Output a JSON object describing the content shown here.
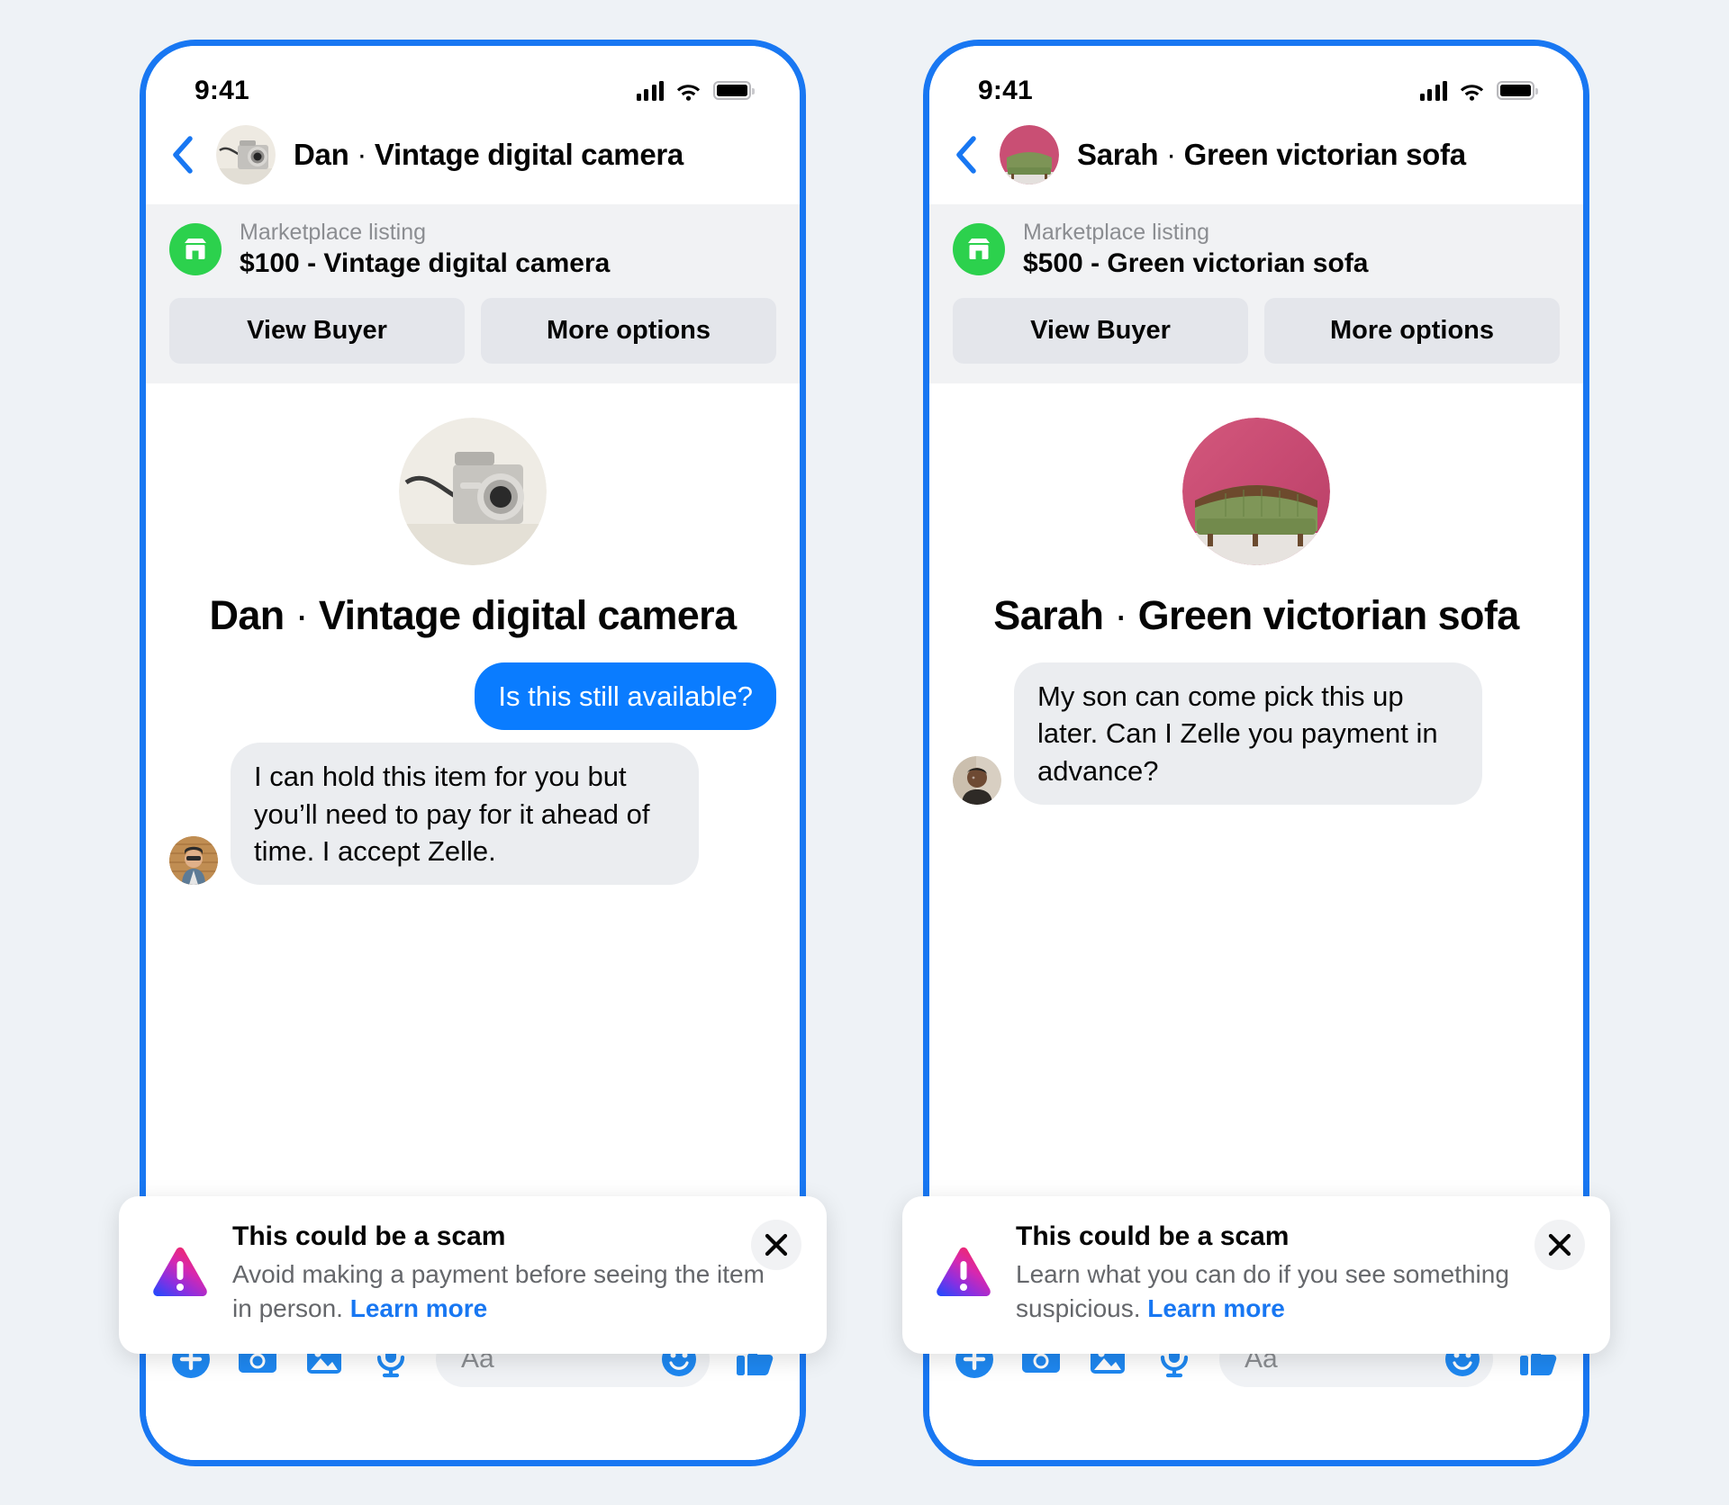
{
  "theme": {
    "page_background": "#eef2f6",
    "phone_frame": "#1877f2",
    "accent_blue": "#1877f2",
    "bubble_out": "#0a7cff",
    "bubble_in": "#ebedf0",
    "marketplace_green": "#2cd14d",
    "muted_text": "#65676b"
  },
  "phones": [
    {
      "status": {
        "time": "9:41",
        "signal_icon": "cellular-signal-icon",
        "wifi_icon": "wifi-icon",
        "battery_icon": "battery-full-icon"
      },
      "header": {
        "back_icon": "back-chevron-icon",
        "avatar_name": "vintage-digital-camera-avatar",
        "title_name": "Dan",
        "title_separator": " · ",
        "title_item": "Vintage digital camera"
      },
      "listing": {
        "store_icon": "marketplace-storefront-icon",
        "label": "Marketplace listing",
        "title": "$100 - Vintage digital camera",
        "price": "$100",
        "item": "Vintage digital camera",
        "buttons": [
          {
            "label": "View Buyer",
            "name": "view-buyer-button"
          },
          {
            "label": "More options",
            "name": "more-options-button"
          }
        ]
      },
      "intro": {
        "avatar_name": "vintage-digital-camera-photo",
        "name": "Dan",
        "separator": " · ",
        "item": "Vintage digital camera"
      },
      "messages": [
        {
          "direction": "out",
          "text": "Is this still available?",
          "avatar": null
        },
        {
          "direction": "in",
          "text": "I can hold this item for you but you’ll need to pay for it ahead of time. I accept Zelle.",
          "avatar": "dan-profile-avatar"
        }
      ],
      "banner": {
        "icon": "scam-warning-triangle-icon",
        "title": "This could be a scam",
        "text": "Avoid making a payment before seeing the item in person. ",
        "link": "Learn more",
        "close_icon": "close-icon"
      },
      "composer": {
        "icons": [
          {
            "name": "plus-circle-icon",
            "label": "add"
          },
          {
            "name": "camera-icon",
            "label": "camera"
          },
          {
            "name": "photo-icon",
            "label": "gallery"
          },
          {
            "name": "microphone-icon",
            "label": "voice"
          }
        ],
        "placeholder": "Aa",
        "emoji_icon": "smiley-face-icon",
        "like_icon": "thumbs-up-icon"
      }
    },
    {
      "status": {
        "time": "9:41",
        "signal_icon": "cellular-signal-icon",
        "wifi_icon": "wifi-icon",
        "battery_icon": "battery-full-icon"
      },
      "header": {
        "back_icon": "back-chevron-icon",
        "avatar_name": "green-victorian-sofa-avatar",
        "title_name": "Sarah",
        "title_separator": " · ",
        "title_item": "Green victorian sofa"
      },
      "listing": {
        "store_icon": "marketplace-storefront-icon",
        "label": "Marketplace listing",
        "title": "$500 - Green victorian sofa",
        "price": "$500",
        "item": "Green victorian sofa",
        "buttons": [
          {
            "label": "View Buyer",
            "name": "view-buyer-button"
          },
          {
            "label": "More options",
            "name": "more-options-button"
          }
        ]
      },
      "intro": {
        "avatar_name": "green-victorian-sofa-photo",
        "name": "Sarah",
        "separator": " · ",
        "item": "Green victorian sofa"
      },
      "messages": [
        {
          "direction": "in",
          "text": "My son can come pick this up later. Can I Zelle you payment in advance?",
          "avatar": "sarah-profile-avatar"
        }
      ],
      "banner": {
        "icon": "scam-warning-triangle-icon",
        "title": "This could be a scam",
        "text": "Learn what you can do if you see something suspicious. ",
        "link": "Learn more",
        "close_icon": "close-icon"
      },
      "composer": {
        "icons": [
          {
            "name": "plus-circle-icon",
            "label": "add"
          },
          {
            "name": "camera-icon",
            "label": "camera"
          },
          {
            "name": "photo-icon",
            "label": "gallery"
          },
          {
            "name": "microphone-icon",
            "label": "voice"
          }
        ],
        "placeholder": "Aa",
        "emoji_icon": "smiley-face-icon",
        "like_icon": "thumbs-up-icon"
      }
    }
  ]
}
